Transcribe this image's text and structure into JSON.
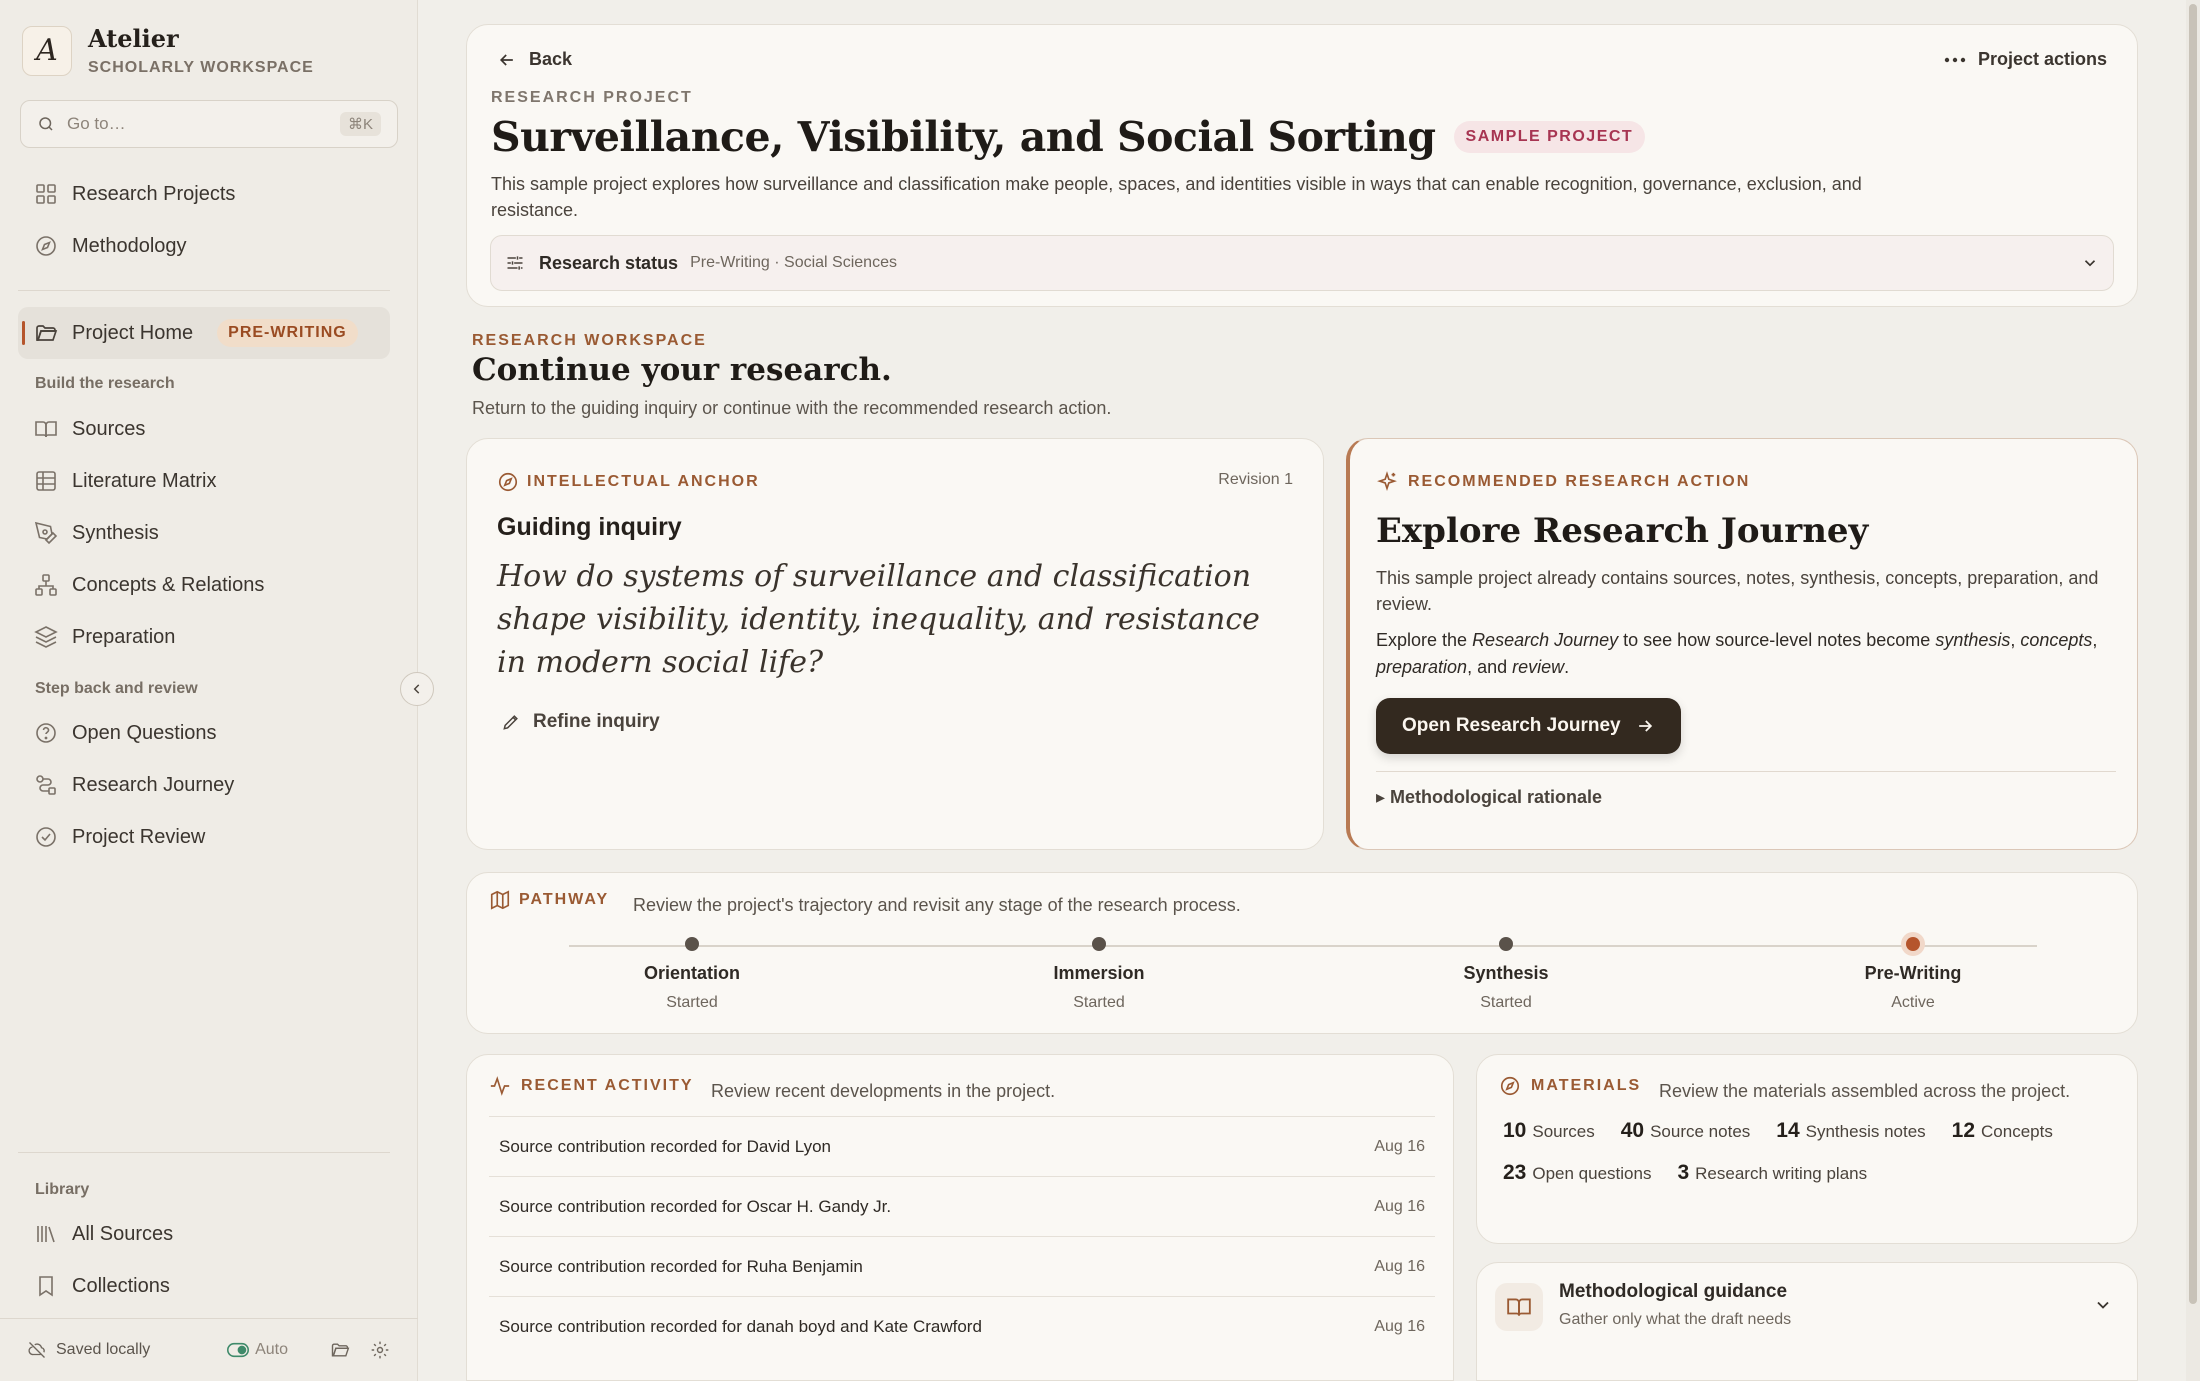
{
  "app": {
    "name": "Atelier",
    "subtitle": "SCHOLARLY WORKSPACE",
    "logo_letter": "A"
  },
  "search": {
    "placeholder": "Go to…",
    "shortcut": "⌘K"
  },
  "sidebar": {
    "top_items": [
      {
        "label": "Research Projects",
        "icon": "grid-icon"
      },
      {
        "label": "Methodology",
        "icon": "compass-icon"
      }
    ],
    "project_home": {
      "label": "Project Home",
      "badge": "PRE-WRITING",
      "icon": "folder-icon"
    },
    "build_section": "Build the research",
    "build_items": [
      {
        "label": "Sources",
        "icon": "book-icon"
      },
      {
        "label": "Literature Matrix",
        "icon": "table-icon"
      },
      {
        "label": "Synthesis",
        "icon": "pen-icon"
      },
      {
        "label": "Concepts & Relations",
        "icon": "network-icon"
      },
      {
        "label": "Preparation",
        "icon": "layers-icon"
      }
    ],
    "review_section": "Step back and review",
    "review_items": [
      {
        "label": "Open Questions",
        "icon": "question-icon"
      },
      {
        "label": "Research Journey",
        "icon": "route-icon"
      },
      {
        "label": "Project Review",
        "icon": "check-circle-icon"
      }
    ],
    "library_section": "Library",
    "library_items": [
      {
        "label": "All Sources",
        "icon": "library-icon"
      },
      {
        "label": "Collections",
        "icon": "bookmark-icon"
      }
    ],
    "footer": {
      "saved": "Saved locally",
      "auto": "Auto"
    }
  },
  "header": {
    "back": "Back",
    "actions": "Project actions",
    "eyebrow": "RESEARCH PROJECT",
    "title": "Surveillance, Visibility, and Social Sorting",
    "badge": "SAMPLE PROJECT",
    "description": "This sample project explores how surveillance and classification make people, spaces, and identities visible in ways that can enable recognition, governance, exclusion, and resistance.",
    "status_label": "Research status",
    "status_value": "Pre-Writing · Social Sciences"
  },
  "workspace": {
    "eyebrow": "RESEARCH WORKSPACE",
    "title": "Continue your research.",
    "description": "Return to the guiding inquiry or continue with the recommended research action."
  },
  "anchor": {
    "eyebrow": "INTELLECTUAL ANCHOR",
    "revision": "Revision 1",
    "heading": "Guiding inquiry",
    "inquiry": "How do systems of surveillance and classification shape visibility, identity, inequality, and resistance in modern social life?",
    "refine": "Refine inquiry"
  },
  "recommended": {
    "eyebrow": "RECOMMENDED RESEARCH ACTION",
    "title": "Explore Research Journey",
    "p1": "This sample project already contains sources, notes, synthesis, concepts, preparation, and review.",
    "p2_a": "Explore the ",
    "p2_journey": "Research Journey",
    "p2_b": " to see how source-level notes become ",
    "p2_synthesis": "synthesis",
    "p2_c": ", ",
    "p2_concepts": "concepts",
    "p2_d": ", ",
    "p2_preparation": "preparation",
    "p2_e": ", and ",
    "p2_review": "review",
    "p2_f": ".",
    "button": "Open Research Journey",
    "rationale": "Methodological rationale"
  },
  "pathway": {
    "eyebrow": "PATHWAY",
    "description": "Review the project's trajectory and revisit any stage of the research process.",
    "stages": [
      {
        "name": "Orientation",
        "state": "Started"
      },
      {
        "name": "Immersion",
        "state": "Started"
      },
      {
        "name": "Synthesis",
        "state": "Started"
      },
      {
        "name": "Pre-Writing",
        "state": "Active"
      }
    ]
  },
  "activity": {
    "eyebrow": "RECENT ACTIVITY",
    "description": "Review recent developments in the project.",
    "rows": [
      {
        "text": "Source contribution recorded for David Lyon",
        "date": "Aug 16"
      },
      {
        "text": "Source contribution recorded for Oscar H. Gandy Jr.",
        "date": "Aug 16"
      },
      {
        "text": "Source contribution recorded for Ruha Benjamin",
        "date": "Aug 16"
      },
      {
        "text": "Source contribution recorded for danah boyd and Kate Crawford",
        "date": "Aug 16"
      }
    ]
  },
  "materials": {
    "eyebrow": "MATERIALS",
    "description": "Review the materials assembled across the project.",
    "items": [
      {
        "count": "10",
        "label": "Sources"
      },
      {
        "count": "40",
        "label": "Source notes"
      },
      {
        "count": "14",
        "label": "Synthesis notes"
      },
      {
        "count": "12",
        "label": "Concepts"
      },
      {
        "count": "23",
        "label": "Open questions"
      },
      {
        "count": "3",
        "label": "Research writing plans"
      }
    ]
  },
  "guidance": {
    "title": "Methodological guidance",
    "subtitle": "Gather only what the draft needs"
  },
  "colors": {
    "accent": "#b5552c",
    "eyebrow": "#9a5a33",
    "button_bg": "#33291f",
    "background": "#f1efea"
  }
}
